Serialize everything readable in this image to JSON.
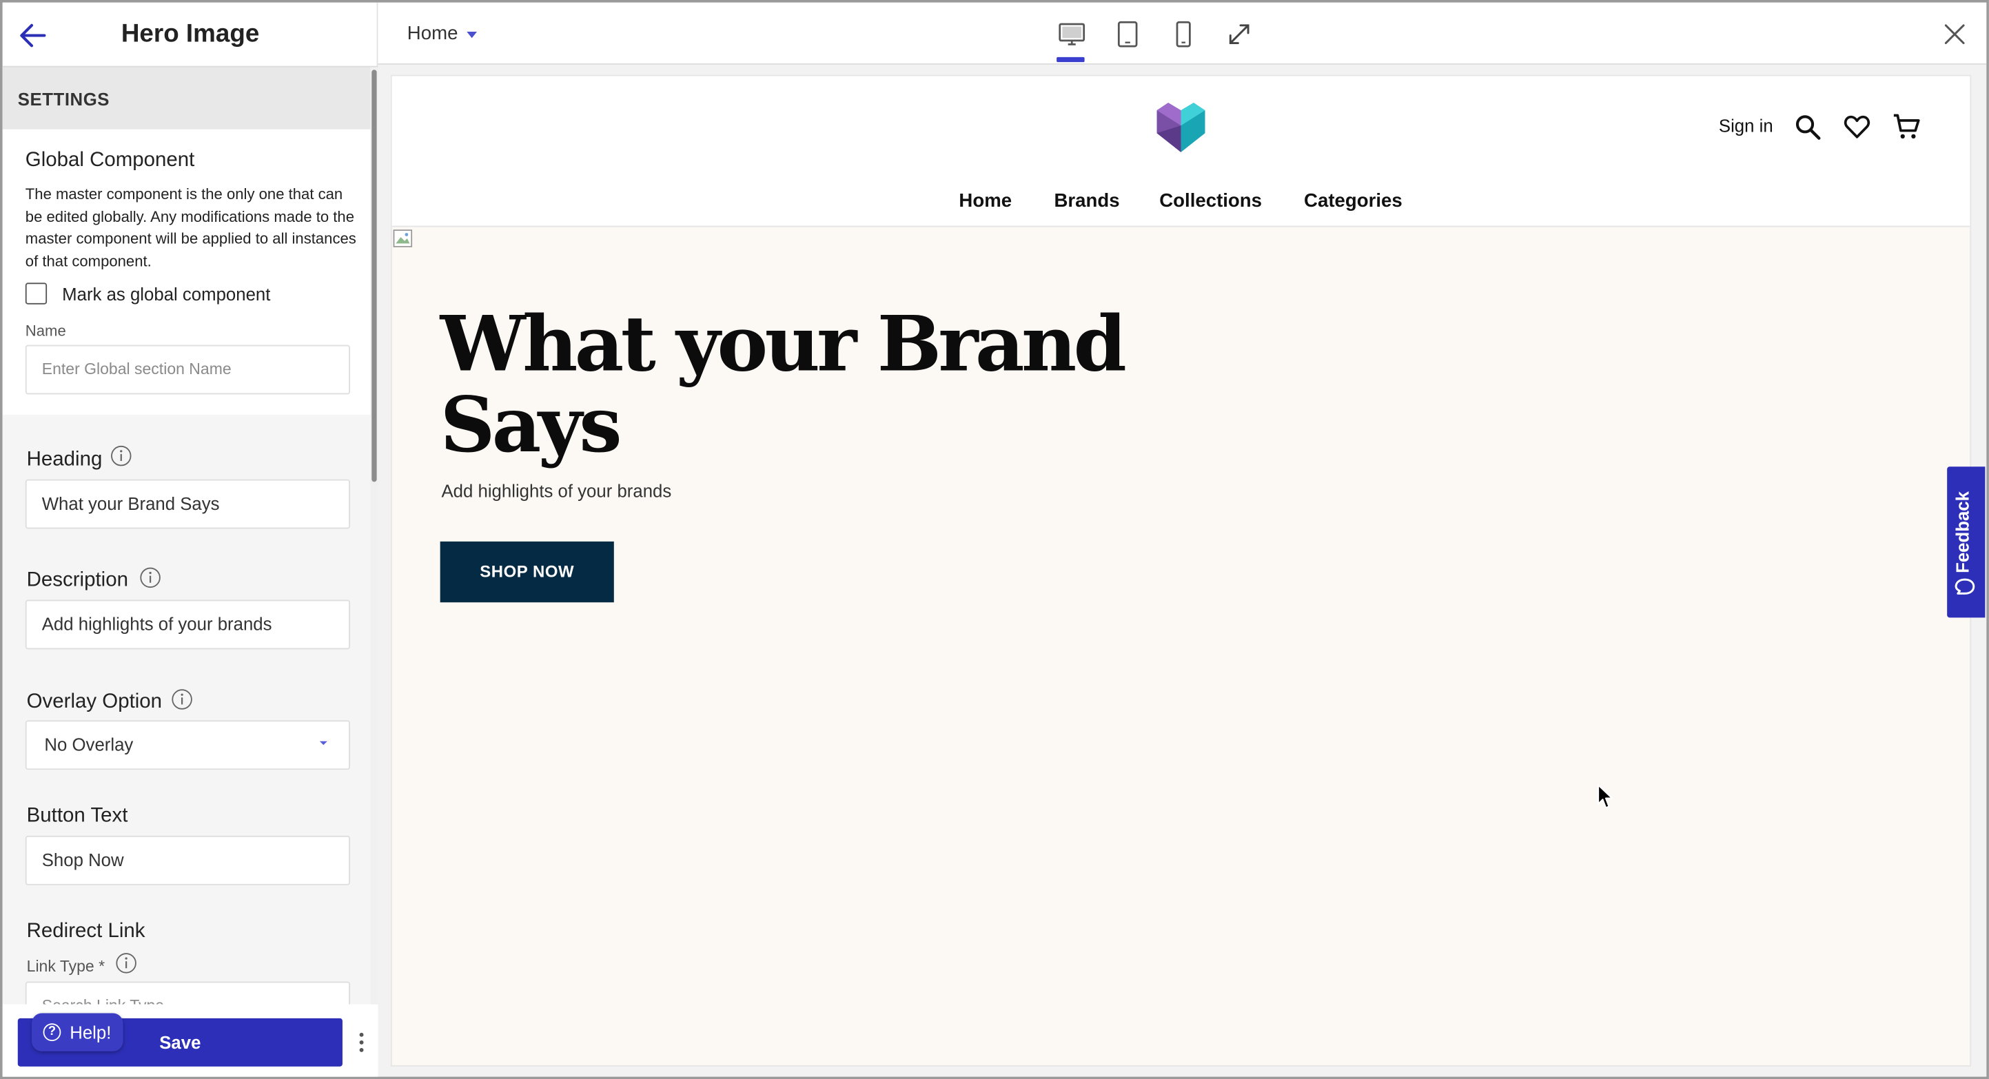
{
  "panel": {
    "title": "Hero Image",
    "settings_label": "SETTINGS",
    "global": {
      "title": "Global Component",
      "description": "The master component is the only one that can be edited globally. Any modifications made to the master component will be applied to all instances of that component.",
      "checkbox_label": "Mark as global component",
      "checkbox_checked": false,
      "name_label": "Name",
      "name_placeholder": "Enter Global section Name"
    },
    "heading": {
      "label": "Heading",
      "value": "What your Brand Says"
    },
    "description": {
      "label": "Description",
      "value": "Add highlights of your brands"
    },
    "overlay": {
      "label": "Overlay Option",
      "value": "No Overlay"
    },
    "button_text": {
      "label": "Button Text",
      "value": "Shop Now"
    },
    "redirect": {
      "label": "Redirect Link",
      "link_type_label": "Link Type *",
      "link_type_placeholder": "Search Link Type"
    },
    "save_label": "Save",
    "help_label": "Help!"
  },
  "topbar": {
    "page": "Home",
    "devices": [
      "desktop-icon",
      "tablet-icon",
      "mobile-icon",
      "fullscreen-icon"
    ],
    "active_device": "desktop"
  },
  "preview": {
    "signin": "Sign in",
    "nav": [
      "Home",
      "Brands",
      "Collections",
      "Categories"
    ],
    "hero_title": "What your Brand Says",
    "hero_description": "Add highlights of your brands",
    "hero_button": "SHOP NOW",
    "background_color": "#fcf8f4",
    "button_color": "#052a44"
  },
  "feedback_label": "Feedback",
  "colors": {
    "accent": "#2d2fb8",
    "active_tab": "#3b3fcf"
  }
}
